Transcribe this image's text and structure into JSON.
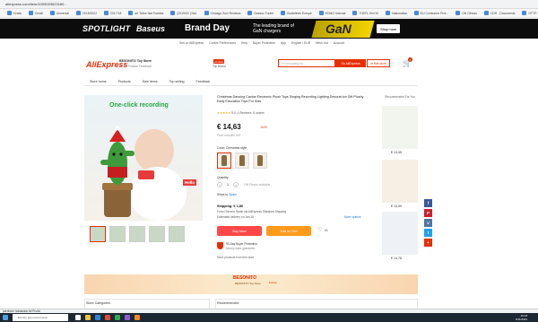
{
  "browser": {
    "url": "aliexpress.com/item/1005003523180...",
    "bookmarks": [
      "Gratis",
      "Gmail",
      "Universal",
      "2015/2022",
      "2017/18",
      "art Tebor Nat Toshiba",
      "[2019/02 ] Nat.",
      "Chicago Soci Reviews",
      "Dassuc Tuulet",
      "Guidelines Europe",
      "EDMO Internat",
      "TOEFL Kirr/10",
      "Nationalise",
      "EU Consumer Prot...",
      "ON Olhxao",
      "CDR - Documents",
      "HTTP: Tras yo phleb"
    ]
  },
  "banner": {
    "spotlight": "SPOTLIGHT",
    "brand": "Baseus",
    "day": "Brand Day",
    "sub1": "The leading brand of",
    "sub2": "GaN chargers",
    "product": "GaN",
    "cta": "Shop now"
  },
  "topnav": [
    "Sell on AliExpress",
    "Cookie Preferences",
    "Help",
    "Buyer Protection",
    "App",
    "English / EUR",
    "Wish List",
    "Account"
  ],
  "header": {
    "logo": "AliExpress",
    "store_name": "BESONITO Toy Store",
    "store_meta": "90.3% Positive Feedback",
    "follow": "+Follow",
    "position": "Top Brand",
    "search_placeholder": "I'm shopping for...",
    "search_onstore": "On AliExpress",
    "search_instore": "In this store",
    "cart_count": "0"
  },
  "store_nav": [
    "Store home",
    "Products",
    "Sale items",
    "Top selling",
    "Feedback"
  ],
  "image": {
    "caption": "One-click recording",
    "hello": "Hello"
  },
  "product": {
    "title": "Christmas Dancing Cactus Electronic Plush Toys Singing Recording Lighting Decorat ion Gift Plushy Early Education Toys For Kids",
    "rating_stars": "★★★★★",
    "rating_value": "5.0",
    "reviews": "4 Reviews",
    "orders": "6 orders",
    "price": "€ 14,63",
    "original_price": "",
    "discount": "-54%",
    "price_note": "Price includes VAT",
    "color_label": "Color: Christmas style",
    "quantity_label": "Quantity:",
    "quantity": "1",
    "quantity_note": "196 Pieces available",
    "ships_to_label": "Ships to",
    "ships_to": "Spain",
    "shipping": "Shipping: € 1,86",
    "shipping_line1": "From China to Spain via AliExpress Standard Shipping",
    "shipping_line2": "Estimated delivery on Jan 16",
    "more_options": "More options",
    "buy_now": "Buy Now",
    "add_to_cart": "Add to Cart",
    "wishlist_count": "80",
    "protection_title": "90-Day Buyer Protection",
    "protection_sub": "Money back guarantee",
    "more_related": "More products from this store"
  },
  "recommended": {
    "label": "Recommended For You",
    "items": [
      {
        "price": "€ 13,45"
      },
      {
        "price": "€ 13,99"
      },
      {
        "price": "€ 14,78"
      }
    ]
  },
  "social": [
    {
      "name": "facebook-icon",
      "glyph": "f",
      "color": "#3b5998"
    },
    {
      "name": "pinterest-icon",
      "glyph": "P",
      "color": "#c8232c"
    },
    {
      "name": "vk-icon",
      "glyph": "v",
      "color": "#4c75a3"
    },
    {
      "name": "twitter-icon",
      "glyph": "t",
      "color": "#1da1f2"
    },
    {
      "name": "more-share-icon",
      "glyph": "+",
      "color": "#e62e04"
    }
  ],
  "store_banner": {
    "name": "BESONITO",
    "sub": "BESONITO Toy Store",
    "follow": "Follow"
  },
  "bottom": {
    "store_categories": "Store Categories",
    "recommended": "Recommended"
  },
  "downloads": {
    "item": "perdicion holwastos tot Prodd"
  },
  "taskbar": {
    "search_placeholder": "Escribe aquí para buscar",
    "time": "16:18",
    "date": "6/11/2021"
  }
}
